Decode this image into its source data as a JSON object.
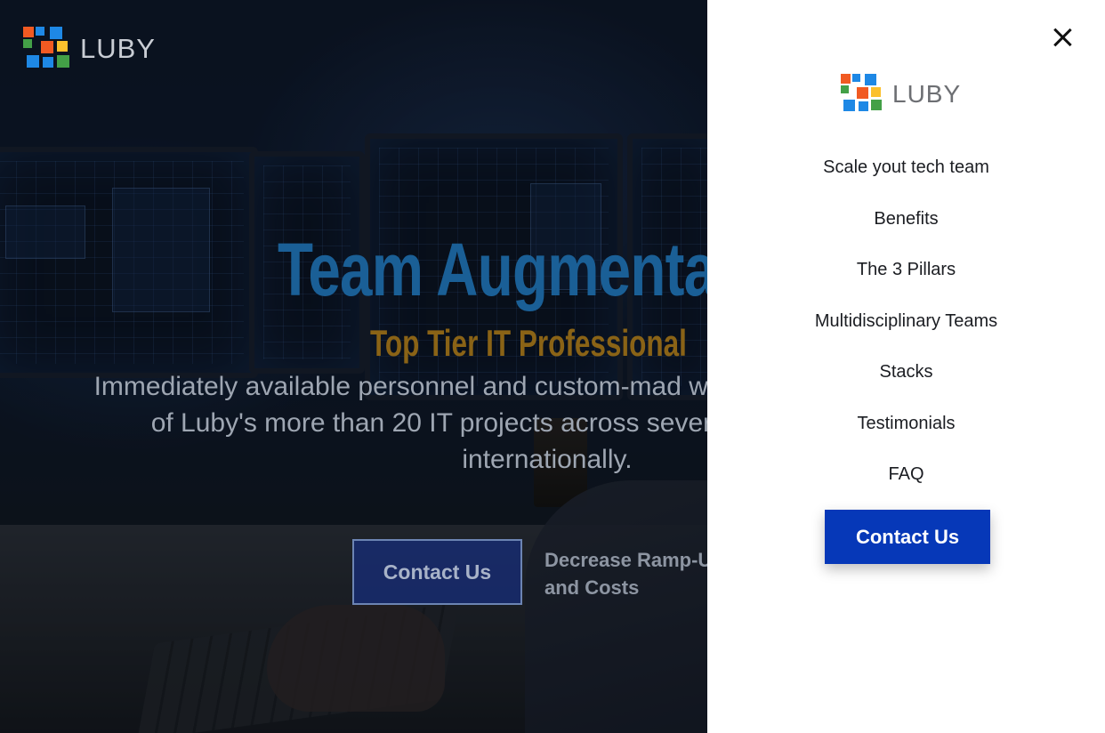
{
  "brand": {
    "logo_text": "LUBY",
    "logo_icon": "luby-pixel-logo-icon",
    "colors": [
      "#f15a22",
      "#1e88e5",
      "#43a047",
      "#fbc02d"
    ]
  },
  "hero": {
    "title": "Team Augmenta",
    "subtitle": "Top Tier IT Professional",
    "description": "Immediately available personnel and custom-mad with the same quality level of Luby's more than 20 IT projects across several industries, both d internationally.",
    "cta_label": "Contact Us",
    "note": "Decrease Ramp-U Time and Costs"
  },
  "menu": {
    "close_icon": "close-icon",
    "items": [
      {
        "label": "Scale yout tech team"
      },
      {
        "label": "Benefits"
      },
      {
        "label": "The 3 Pillars"
      },
      {
        "label": "Multidisciplinary Teams"
      },
      {
        "label": "Stacks"
      },
      {
        "label": "Testimonials"
      },
      {
        "label": "FAQ"
      }
    ],
    "cta_label": "Contact Us",
    "cta_color": "#0638b8"
  }
}
